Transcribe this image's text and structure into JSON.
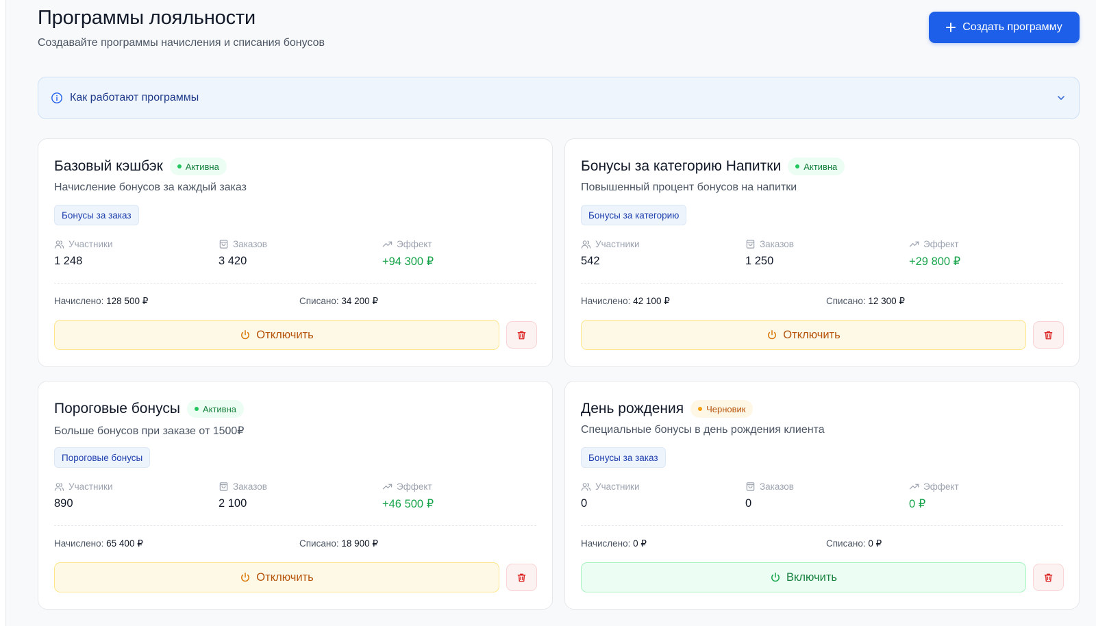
{
  "header": {
    "title": "Программы лояльности",
    "subtitle": "Создавайте программы начисления и списания бонусов",
    "create_label": "Создать программу"
  },
  "info_panel": {
    "title": "Как работают программы",
    "expanded": false
  },
  "colors": {
    "accent": "#1d5fe8",
    "active": "#22c55e",
    "draft": "#f59e0b",
    "effect": "#16a34a",
    "danger": "#dc2626"
  },
  "programs": [
    {
      "title": "Базовый кэшбэк",
      "status": "Активна",
      "description": "Начисление бонусов за каждый заказ",
      "type": "Бонусы за заказ",
      "participants_label": "Участники",
      "participants": "1 248",
      "orders_label": "Заказов",
      "orders": "3 420",
      "effect_label": "Эффект",
      "effect": "+94 300 ₽",
      "accrued_label": "Начислено:",
      "accrued": "128 500 ₽",
      "spent_label": "Списано:",
      "spent": "34 200 ₽",
      "action": "Отключить"
    },
    {
      "title": "Бонусы за категорию Напитки",
      "status": "Активна",
      "description": "Повышенный процент бонусов на напитки",
      "type": "Бонусы за категорию",
      "participants_label": "Участники",
      "participants": "542",
      "orders_label": "Заказов",
      "orders": "1 250",
      "effect_label": "Эффект",
      "effect": "+29 800 ₽",
      "accrued_label": "Начислено:",
      "accrued": "42 100 ₽",
      "spent_label": "Списано:",
      "spent": "12 300 ₽",
      "action": "Отключить"
    },
    {
      "title": "Пороговые бонусы",
      "status": "Активна",
      "description": "Больше бонусов при заказе от 1500₽",
      "type": "Пороговые бонусы",
      "participants_label": "Участники",
      "participants": "890",
      "orders_label": "Заказов",
      "orders": "2 100",
      "effect_label": "Эффект",
      "effect": "+46 500 ₽",
      "accrued_label": "Начислено:",
      "accrued": "65 400 ₽",
      "spent_label": "Списано:",
      "spent": "18 900 ₽",
      "action": "Отключить"
    },
    {
      "title": "День рождения",
      "status": "Черновик",
      "description": "Специальные бонусы в день рождения клиента",
      "type": "Бонусы за заказ",
      "participants_label": "Участники",
      "participants": "0",
      "orders_label": "Заказов",
      "orders": "0",
      "effect_label": "Эффект",
      "effect": "0 ₽",
      "accrued_label": "Начислено:",
      "accrued": "0 ₽",
      "spent_label": "Списано:",
      "spent": "0 ₽",
      "action": "Включить"
    }
  ]
}
